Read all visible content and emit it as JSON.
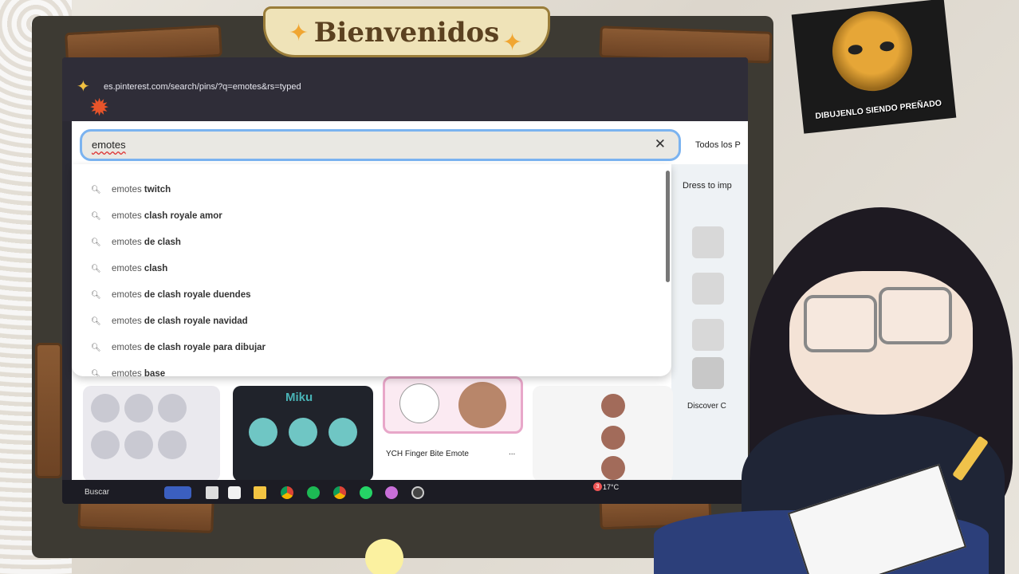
{
  "overlay": {
    "banner_title": "Bienvenidos",
    "meme_caption": "DIBUJENLO SIENDO PREÑADO"
  },
  "browser": {
    "url": "es.pinterest.com/search/pins/?q=emotes&rs=typed"
  },
  "search": {
    "value": "emotes",
    "filter_label": "Todos los P",
    "suggestions": [
      {
        "base": "emotes",
        "rest": " twitch"
      },
      {
        "base": "emotes",
        "rest": " clash royale amor"
      },
      {
        "base": "emotes",
        "rest": " de clash"
      },
      {
        "base": "emotes",
        "rest": " clash"
      },
      {
        "base": "emotes",
        "rest": " de clash royale duendes"
      },
      {
        "base": "emotes",
        "rest": " de clash royale navidad"
      },
      {
        "base": "emotes",
        "rest": " de clash royale para dibujar"
      },
      {
        "base": "emotes",
        "rest": " base"
      }
    ]
  },
  "side": {
    "dress_label": "Dress to imp",
    "discover_label": "Discover C"
  },
  "results": {
    "miku_label": "Miku",
    "ych_title": "YCH Finger Bite Emote",
    "ych_more": "..."
  },
  "taskbar": {
    "search_label": "Buscar",
    "temperature": "17°C",
    "notification_count": "3"
  },
  "colors": {
    "search_border": "#7bb3f0",
    "screen_bg": "#2b2a33",
    "frame_wood": "#8a5a33"
  }
}
